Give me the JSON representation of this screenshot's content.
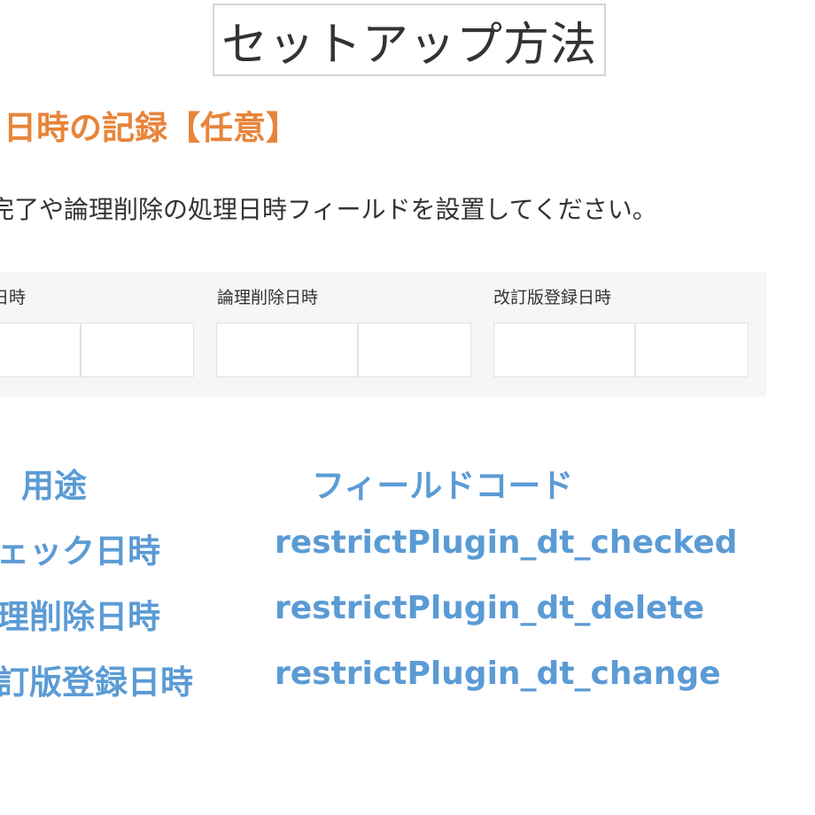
{
  "title": "セットアップ方法",
  "section": {
    "heading": "日時の記録【任意】",
    "description": "完了や論理削除の処理日時フィールドを設置してください。"
  },
  "form_fields": [
    {
      "label": "ク日時"
    },
    {
      "label": "論理削除日時"
    },
    {
      "label": "改訂版登録日時"
    }
  ],
  "table": {
    "headers": {
      "usage": "用途",
      "code": "フィールドコード"
    },
    "rows": [
      {
        "usage": "ェック日時",
        "code": "restrictPlugin_dt_checked"
      },
      {
        "usage": "理削除日時",
        "code": "restrictPlugin_dt_delete"
      },
      {
        "usage": "訂版登録日時",
        "code": "restrictPlugin_dt_change"
      }
    ]
  },
  "colors": {
    "heading_orange": "#e8843a",
    "table_blue": "#5b9bd5",
    "panel_gray": "#f5f6f8",
    "title_border": "#d4d4d4"
  }
}
